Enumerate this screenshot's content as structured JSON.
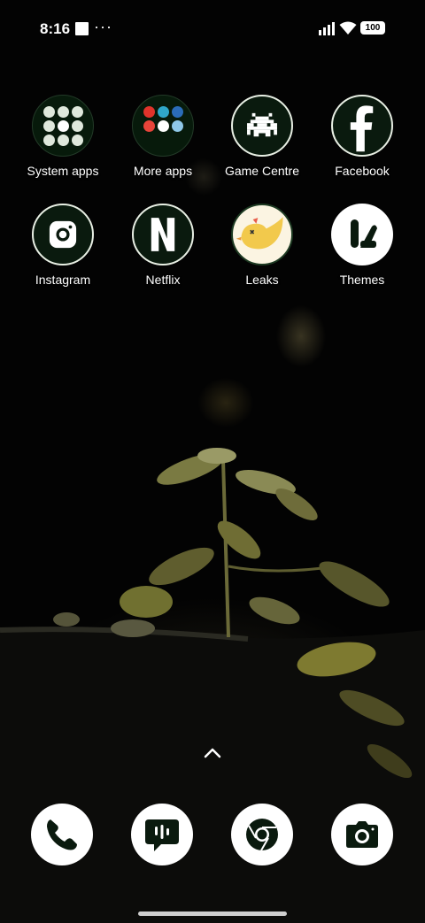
{
  "status_bar": {
    "time": "8:16",
    "battery": "100",
    "overflow": "···"
  },
  "apps": [
    {
      "label": "System apps",
      "icon": "folder-icon"
    },
    {
      "label": "More apps",
      "icon": "folder-icon"
    },
    {
      "label": "Game Centre",
      "icon": "space-invader-icon"
    },
    {
      "label": "Facebook",
      "icon": "facebook-icon"
    },
    {
      "label": "Instagram",
      "icon": "instagram-icon"
    },
    {
      "label": "Netflix",
      "icon": "netflix-icon"
    },
    {
      "label": "Leaks",
      "icon": "bird-icon"
    },
    {
      "label": "Themes",
      "icon": "themes-icon"
    }
  ],
  "dock": [
    "phone-icon",
    "messages-icon",
    "chrome-icon",
    "camera-icon"
  ],
  "colors": {
    "icon_dark": "#0a1a0e",
    "leaks_yellow": "#f2c94c"
  }
}
